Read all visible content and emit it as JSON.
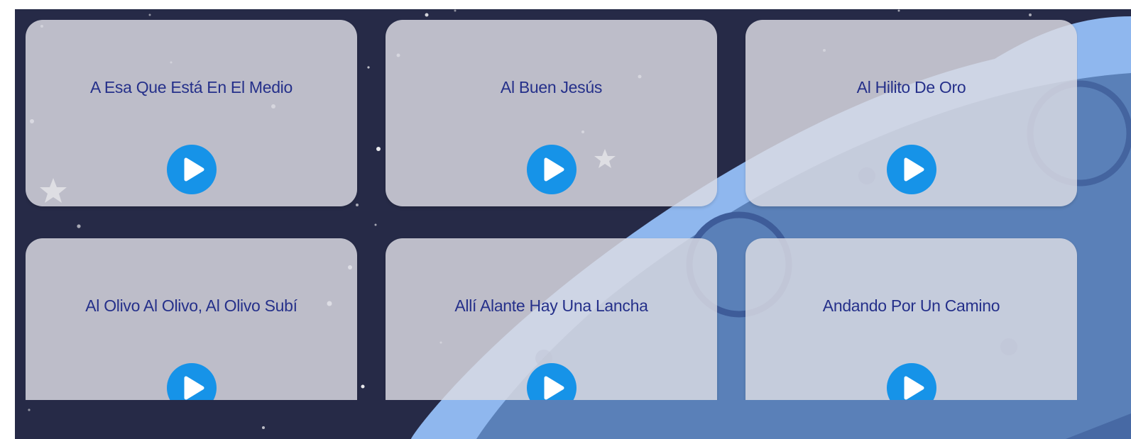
{
  "songs": [
    {
      "title": "A Esa Que Está En El Medio"
    },
    {
      "title": "Al Buen Jesús"
    },
    {
      "title": "Al Hilito De Oro"
    },
    {
      "title": "Al Olivo Al Olivo, Al Olivo Subí"
    },
    {
      "title": "Allí Alante Hay Una Lancha"
    },
    {
      "title": "Andando Por Un Camino"
    }
  ],
  "icons": {
    "play": "play-icon",
    "star": "star-icon",
    "moon": "moon-icon"
  },
  "colors": {
    "background": "#262a47",
    "card": "#dadae2",
    "title_text": "#25308a",
    "play_button": "#1693e8",
    "moon_light": "#8fb7ee",
    "moon_dark": "#5a80b8"
  }
}
